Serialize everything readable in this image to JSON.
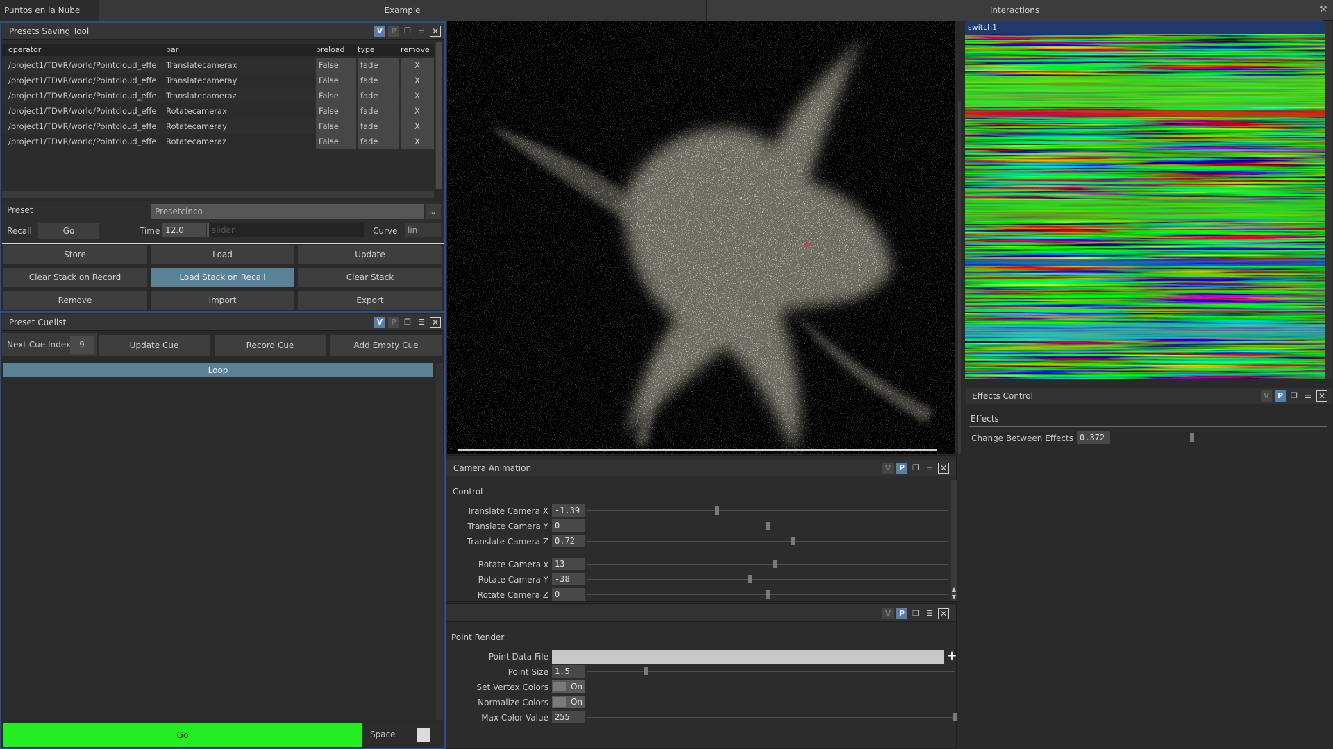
{
  "tabs": {
    "left": "Puntos en la Nube",
    "center": "Example",
    "right": "Interactions"
  },
  "presets_tool": {
    "title": "Presets Saving Tool",
    "columns": [
      "operator",
      "par",
      "preload",
      "type",
      "remove"
    ],
    "rows": [
      {
        "operator": "/project1/TDVR/world/Pointcloud_effe",
        "par": "Translatecamerax",
        "preload": "False",
        "type": "fade",
        "remove": "X"
      },
      {
        "operator": "/project1/TDVR/world/Pointcloud_effe",
        "par": "Translatecameray",
        "preload": "False",
        "type": "fade",
        "remove": "X"
      },
      {
        "operator": "/project1/TDVR/world/Pointcloud_effe",
        "par": "Translatecameraz",
        "preload": "False",
        "type": "fade",
        "remove": "X"
      },
      {
        "operator": "/project1/TDVR/world/Pointcloud_effe",
        "par": "Rotatecamerax",
        "preload": "False",
        "type": "fade",
        "remove": "X"
      },
      {
        "operator": "/project1/TDVR/world/Pointcloud_effe",
        "par": "Rotatecameray",
        "preload": "False",
        "type": "fade",
        "remove": "X"
      },
      {
        "operator": "/project1/TDVR/world/Pointcloud_effe",
        "par": "Rotatecameraz",
        "preload": "False",
        "type": "fade",
        "remove": "X"
      }
    ],
    "preset_label": "Preset",
    "preset_value": "Presetcinco",
    "recall_label": "Recall",
    "go_label": "Go",
    "time_label": "Time",
    "time_value": "12.0",
    "slider_label": "slider",
    "curve_label": "Curve",
    "curve_value": "lin",
    "buttons": {
      "store": "Store",
      "load": "Load",
      "update": "Update",
      "clear_record": "Clear Stack on Record",
      "load_recall": "Load Stack on Recall",
      "clear_stack": "Clear Stack",
      "remove": "Remove",
      "import": "Import",
      "export": "Export"
    }
  },
  "cuelist": {
    "title": "Preset Cuelist",
    "next_cue_label": "Next Cue Index",
    "next_cue_value": "9",
    "update_cue": "Update Cue",
    "record_cue": "Record Cue",
    "add_empty_cue": "Add Empty Cue",
    "loop": "Loop",
    "go": "Go",
    "space": "Space",
    "go_color": "#22ee22"
  },
  "interactions": {
    "node_name": "switch1"
  },
  "camera_animation": {
    "title": "Camera Animation",
    "section": "Control",
    "params": [
      {
        "label": "Translate Camera X",
        "value": "-1.39",
        "norm": 0.36
      },
      {
        "label": "Translate Camera Y",
        "value": "0",
        "norm": 0.5
      },
      {
        "label": "Translate Camera Z",
        "value": "0.72",
        "norm": 0.57
      },
      {
        "label": "Rotate Camera x",
        "value": "13",
        "norm": 0.52
      },
      {
        "label": "Rotate Camera Y",
        "value": "-38",
        "norm": 0.45
      },
      {
        "label": "Rotate Camera Z",
        "value": "0",
        "norm": 0.5
      }
    ]
  },
  "point_render": {
    "section": "Point Render",
    "point_data_file_label": "Point Data File",
    "point_size_label": "Point Size",
    "point_size_value": "1.5",
    "set_vertex_colors_label": "Set Vertex Colors",
    "set_vertex_colors_value": "On",
    "normalize_colors_label": "Normalize Colors",
    "normalize_colors_value": "On",
    "max_color_label": "Max Color Value",
    "max_color_value": "255"
  },
  "effects_control": {
    "title": "Effects Control",
    "section": "Effects",
    "param_label": "Change Between Effects",
    "param_value": "0.372",
    "norm": 0.37
  },
  "header_icons": {
    "v": "V",
    "p": "P"
  }
}
